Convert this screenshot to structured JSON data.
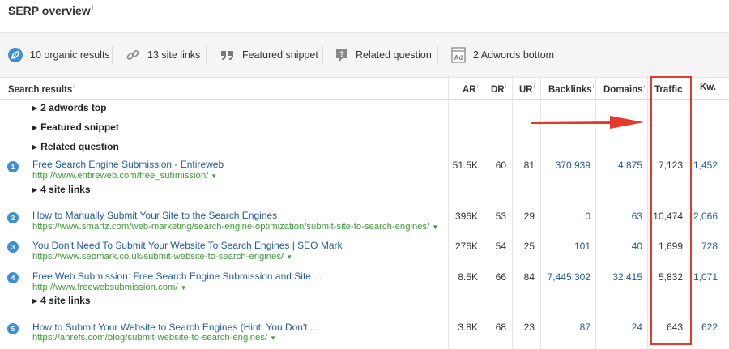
{
  "title": "SERP overview",
  "info_mark": "i",
  "summary": [
    {
      "icon": "leaf-circle-icon",
      "label": "10 organic results"
    },
    {
      "icon": "chain-link-icon",
      "label": "13 site links"
    },
    {
      "icon": "quote-icon",
      "label": "Featured snippet"
    },
    {
      "icon": "question-box-icon",
      "label": "Related question"
    },
    {
      "icon": "ad-icon",
      "icon_text": "Ad",
      "label": "2 Adwords bottom"
    }
  ],
  "columns": {
    "search_results": "Search results",
    "ar": "AR",
    "dr": "DR",
    "ur": "UR",
    "backlinks": "Backlinks",
    "domains": "Domains",
    "traffic": "Traffic",
    "kw": "Kw."
  },
  "toggles": [
    "2 adwords top",
    "Featured snippet",
    "Related question"
  ],
  "results": [
    {
      "rank": "1",
      "title": "Free Search Engine Submission - Entireweb",
      "url": "http://www.entireweb.com/free_submission/",
      "ar": "51.5K",
      "dr": "60",
      "ur": "81",
      "backlinks": "370,939",
      "domains": "4,875",
      "traffic": "7,123",
      "kw": "1,452",
      "site_links": "4 site links"
    },
    {
      "rank": "2",
      "title": "How to Manually Submit Your Site to the Search Engines",
      "url": "https://www.smartz.com/web-marketing/search-engine-optimization/submit-site-to-search-engines/",
      "ar": "396K",
      "dr": "53",
      "ur": "29",
      "backlinks": "0",
      "domains": "63",
      "traffic": "10,474",
      "kw": "2,066"
    },
    {
      "rank": "3",
      "title": "You Don't Need To Submit Your Website To Search Engines | SEO Mark",
      "url": "https://www.seomark.co.uk/submit-website-to-search-engines/",
      "ar": "276K",
      "dr": "54",
      "ur": "25",
      "backlinks": "101",
      "domains": "40",
      "traffic": "1,699",
      "kw": "728"
    },
    {
      "rank": "4",
      "title": "Free Web Submission: Free Search Engine Submission and Site ...",
      "url": "http://www.freewebsubmission.com/",
      "ar": "8.5K",
      "dr": "66",
      "ur": "84",
      "backlinks": "7,445,302",
      "domains": "32,415",
      "traffic": "5,832",
      "kw": "1,071",
      "site_links": "4 site links"
    },
    {
      "rank": "5",
      "title": "How to Submit Your Website to Search Engines (Hint: You Don't ...",
      "url": "https://ahrefs.com/blog/submit-website-to-search-engines/",
      "ar": "3.8K",
      "dr": "68",
      "ur": "23",
      "backlinks": "87",
      "domains": "24",
      "traffic": "643",
      "kw": "622"
    }
  ],
  "colors": {
    "accent_blue": "#3e8fd8",
    "link": "#1f5a9e",
    "url_green": "#3f9a3a",
    "highlight": "#e8382c"
  }
}
